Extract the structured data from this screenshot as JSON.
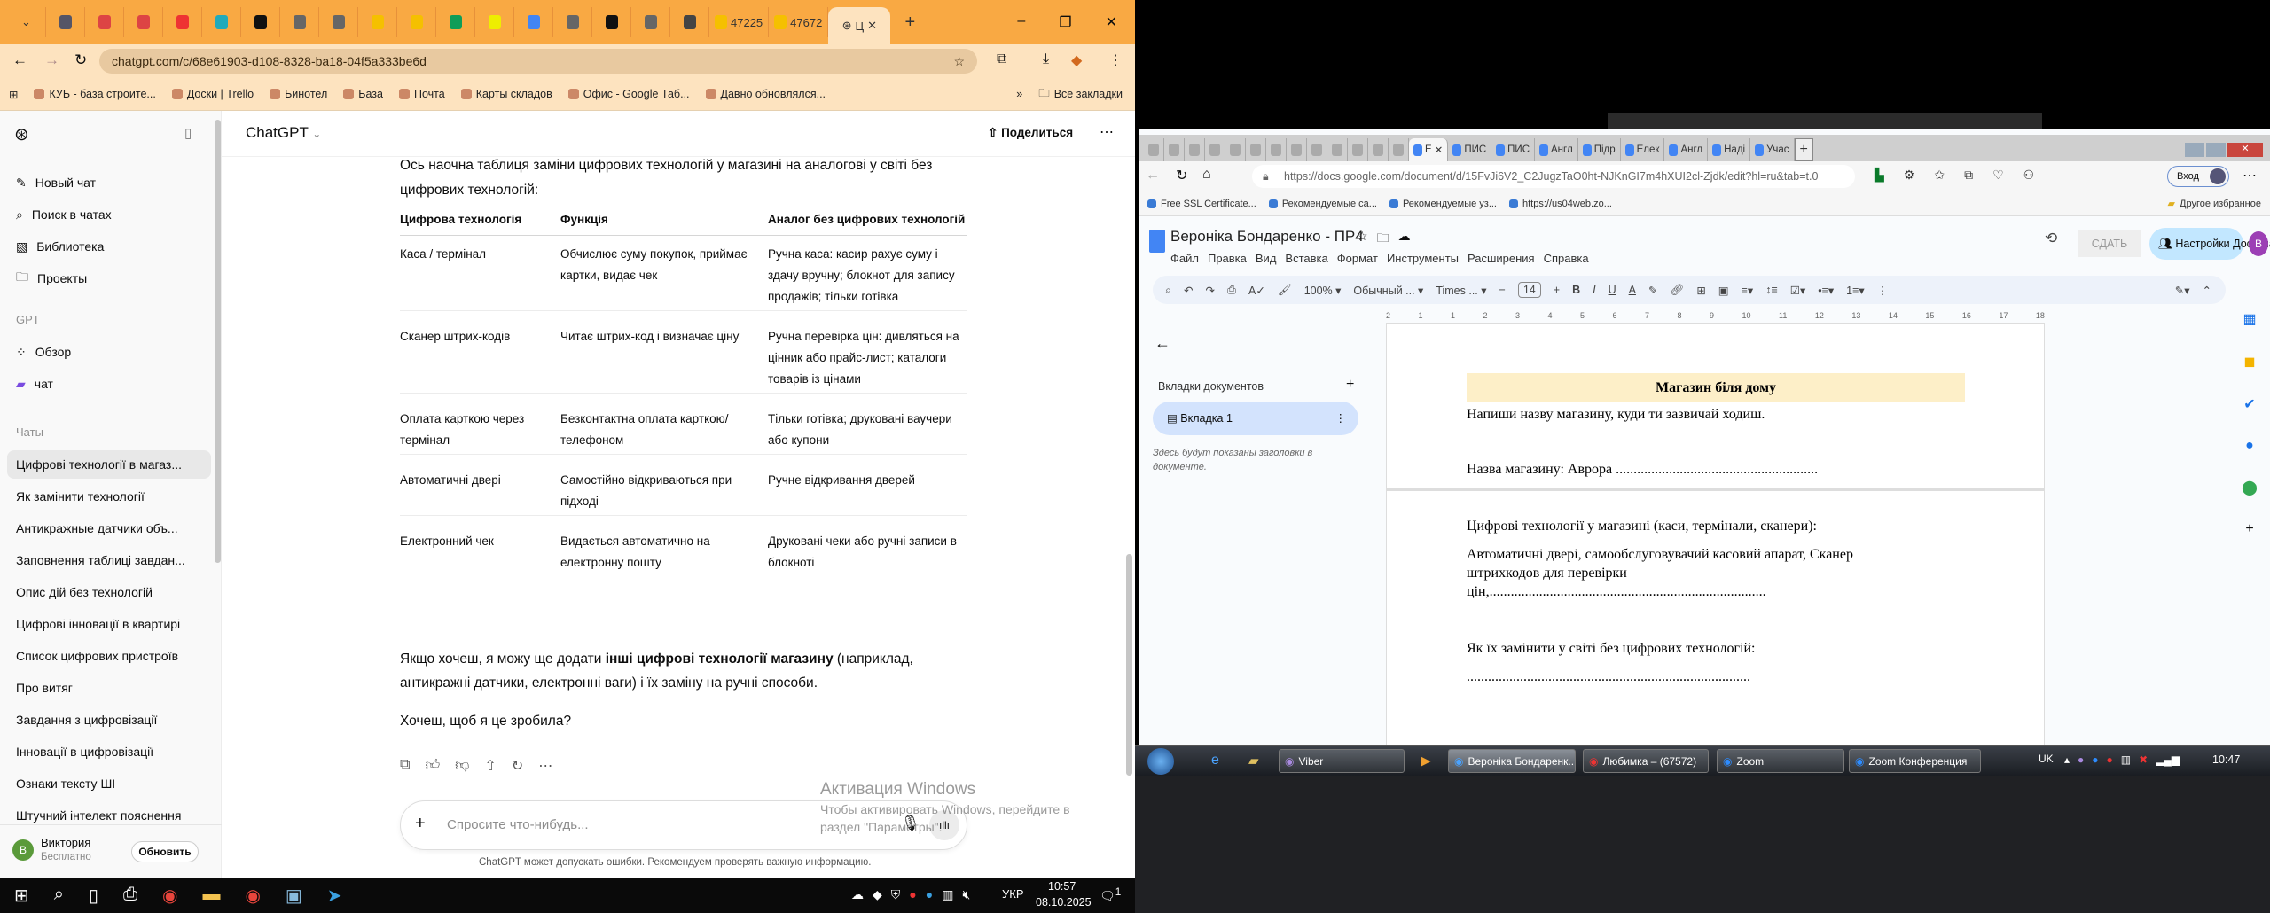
{
  "left_browser": {
    "tabs": [
      {
        "icon": "doc-icon",
        "label": ""
      },
      {
        "icon": "gmail-icon",
        "label": ""
      },
      {
        "icon": "gmail-icon",
        "label": ""
      },
      {
        "icon": "heart-icon",
        "label": ""
      },
      {
        "icon": "cl-icon",
        "label": ""
      },
      {
        "icon": "c-icon",
        "label": ""
      },
      {
        "icon": "app-icon",
        "label": ""
      },
      {
        "icon": "app-icon",
        "label": ""
      },
      {
        "icon": "fire-icon",
        "label": ""
      },
      {
        "icon": "fire-icon",
        "label": ""
      },
      {
        "icon": "sheets-icon",
        "label": ""
      },
      {
        "icon": "x-icon",
        "label": ""
      },
      {
        "icon": "google-icon",
        "label": ""
      },
      {
        "icon": "app-icon",
        "label": ""
      },
      {
        "icon": "pl-icon",
        "label": ""
      },
      {
        "icon": "app-icon",
        "label": ""
      },
      {
        "icon": "openai-icon",
        "label": ""
      },
      {
        "icon": "fire-icon",
        "label": "47225"
      },
      {
        "icon": "fire-icon",
        "label": "47672"
      }
    ],
    "active_tab": "Ц",
    "url": "chatgpt.com/c/68e61903-d108-8328-ba18-04f5a333be6d",
    "bookmarks": [
      "КУБ - база строите...",
      "Доски | Trello",
      "Бинотел",
      "База",
      "Почта",
      "Карты складов",
      "Офис - Google Таб...",
      "Давно обновлялся..."
    ],
    "all_bookmarks": "Все закладки"
  },
  "chatgpt": {
    "sidebar": {
      "nav": [
        "Новый чат",
        "Поиск в чатах",
        "Библиотека",
        "Проекты"
      ],
      "gpt_label": "GPT",
      "gpts": [
        "Обзор",
        "чат"
      ],
      "chats_label": "Чаты",
      "chats": [
        "Цифрові технології в магаз...",
        "Як замінити технології",
        "Антикражные датчики объ...",
        "Заповнення таблиці завдан...",
        "Опис дій без технологій",
        "Цифрові інновації в квартирі",
        "Список цифрових пристроїв",
        "Про витяг",
        "Завдання з цифровізації",
        "Інновації в цифровізації",
        "Ознаки тексту ШІ",
        "Штучний інтелект пояснення"
      ],
      "user": {
        "avatar": "В",
        "name": "Виктория",
        "plan": "Бесплатно",
        "upgrade": "Обновить"
      }
    },
    "header": {
      "title": "ChatGPT",
      "share": "Поделиться"
    },
    "intro": [
      "Ось наочна таблиця заміни цифрових технологій у магазині на аналогові у світі без",
      "цифрових технологій:"
    ],
    "table": {
      "headers": [
        "Цифрова технологія",
        "Функція",
        "Аналог без цифрових технологій"
      ],
      "rows": [
        [
          "Каса / термінал",
          "Обчислює суму покупок, приймає картки, видає чек",
          "Ручна каса: касир рахує суму і здачу вручну; блокнот для запису продажів; тільки готівка"
        ],
        [
          "Сканер штрих-кодів",
          "Читає штрих-код і визначає ціну",
          "Ручна перевірка цін: дивляться на цінник або прайс-лист; каталоги товарів із цінами"
        ],
        [
          "Оплата карткою через термінал",
          "Безконтактна оплата карткою/ телефоном",
          "Тільки готівка; друковані ваучери або купони"
        ],
        [
          "Автоматичні двері",
          "Самостійно відкриваються при підході",
          "Ручне відкривання дверей"
        ],
        [
          "Електронний чек",
          "Видається автоматично на електронну пошту",
          "Друковані чеки або ручні записи в блокноті"
        ]
      ]
    },
    "followup": {
      "pre": "Якщо хочеш, я можу ще додати ",
      "bold": "інші цифрові технології магазину",
      "post": " (наприклад,",
      "line2": "антикражні датчики, електронні ваги) і їх заміну на ручні способи."
    },
    "question": "Хочеш, щоб я це зробила?",
    "input_placeholder": "Спросите что-нибудь...",
    "disclaimer": "ChatGPT может допускать ошибки. Рекомендуем проверять важную информацию.",
    "watermark": {
      "title": "Активация Windows",
      "line1": "Чтобы активировать Windows, перейдите в",
      "line2": "раздел \"Параметры\"."
    }
  },
  "win10_taskbar": {
    "lang": "УКР",
    "time": "10:57",
    "date": "08.10.2025",
    "notifications": "1"
  },
  "docs_browser": {
    "tabs": [
      "Е",
      "ПИС",
      "ПИС",
      "Англ",
      "Підр",
      "Елек",
      "Англ",
      "Наді",
      "Учас"
    ],
    "url": "https://docs.google.com/document/d/15FvJi6V2_C2JugzTaO0ht-NJKnGI7m4hXUI2cl-Zjdk/edit?hl=ru&tab=t.0",
    "signin": "Вход",
    "bookmarks": [
      "Free SSL Certificate...",
      "Рекомендуемые са...",
      "Рекомендуемые уз...",
      "https://us04web.zo..."
    ],
    "other_bookmarks": "Другое избранное"
  },
  "docs": {
    "title": "Вероніка Бондаренко - ПР4",
    "menu": [
      "Файл",
      "Правка",
      "Вид",
      "Вставка",
      "Формат",
      "Инструменты",
      "Расширения",
      "Справка"
    ],
    "submit": "СДАТЬ",
    "share": "Настройки Доступа",
    "avatar": "В",
    "toolbar": {
      "zoom": "100%",
      "style": "Обычный ...",
      "font": "Times ...",
      "size": "14"
    },
    "ruler": [
      "2",
      "1",
      "1",
      "2",
      "3",
      "4",
      "5",
      "6",
      "7",
      "8",
      "9",
      "10",
      "11",
      "12",
      "13",
      "14",
      "15",
      "16",
      "17",
      "18"
    ],
    "side": {
      "header": "Вкладки документов",
      "tab": "Вкладка 1",
      "hint": "Здесь будут показаны заголовки в документе."
    },
    "content": {
      "heading": "Магазин біля дому",
      "p1": "Напиши назву магазину, куди ти зазвичай ходиш.",
      "p2": "Назва магазину: Аврора .........................................................",
      "p3": "Цифрові технології у магазині (каси, термінали, сканери):",
      "p4a": "Автоматичні двері, самообслуговувачий касовий апарат, Сканер",
      "p4b": "штрихкодов  для перевірки",
      "p4c": "цін,..............................................................................",
      "p5": "Як їх замінити у світі без цифрових технологій:",
      "p6": "................................................................................"
    }
  },
  "win7_taskbar": {
    "buttons": [
      "Viber",
      "Вероніка Бондаренк...",
      "Любимка – (67572)",
      "Zoom",
      "Zoom Конференция"
    ],
    "lang": "UK",
    "time": "10:47"
  }
}
